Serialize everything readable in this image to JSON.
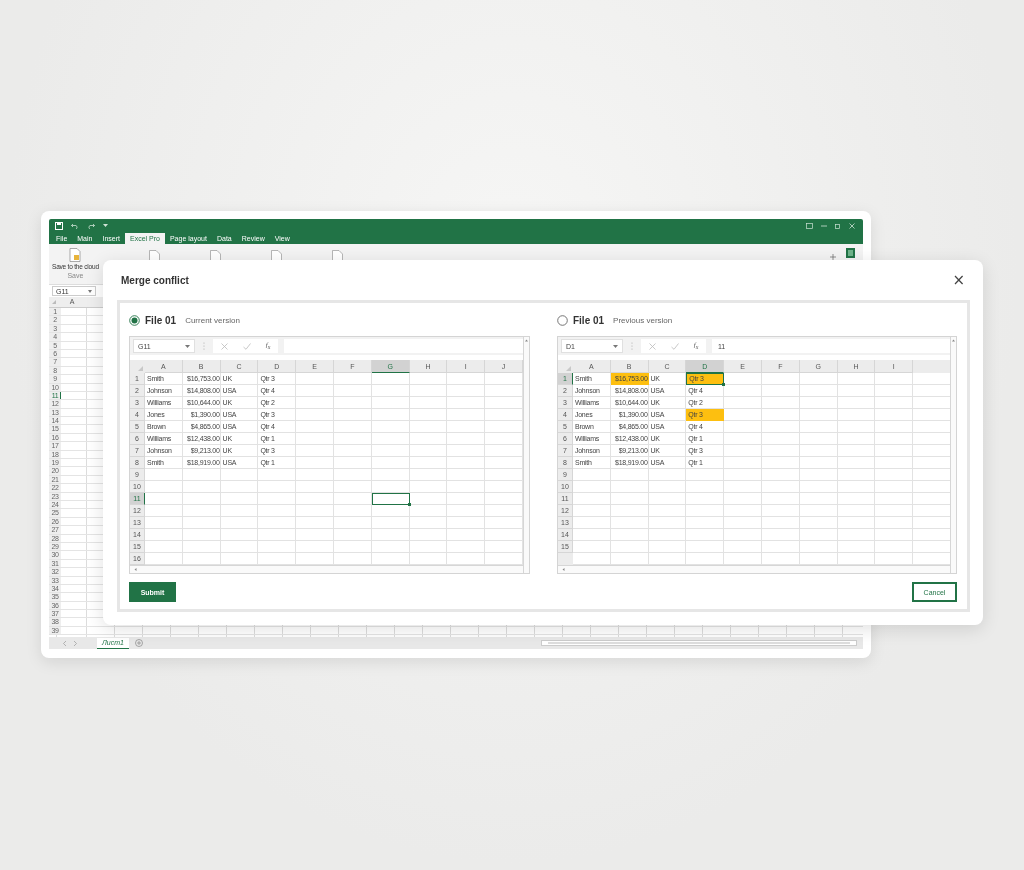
{
  "background_window": {
    "tabs": [
      {
        "label": "File",
        "selected": false
      },
      {
        "label": "Main",
        "selected": false
      },
      {
        "label": "Insert",
        "selected": false
      },
      {
        "label": "Excel Pro",
        "selected": true
      },
      {
        "label": "Page layout",
        "selected": false
      },
      {
        "label": "Data",
        "selected": false
      },
      {
        "label": "Review",
        "selected": false
      },
      {
        "label": "View",
        "selected": false
      }
    ],
    "ribbon_button": "Save to the cloud",
    "ribbon_group": "Save",
    "name_box": "G11",
    "column_headers": [
      "A"
    ],
    "row_numbers": [
      {
        "label": "1",
        "selected": false
      },
      {
        "label": "2",
        "selected": false
      },
      {
        "label": "3",
        "selected": false
      },
      {
        "label": "4",
        "selected": false
      },
      {
        "label": "5",
        "selected": false
      },
      {
        "label": "6",
        "selected": false
      },
      {
        "label": "7",
        "selected": false
      },
      {
        "label": "8",
        "selected": false
      },
      {
        "label": "9",
        "selected": false
      },
      {
        "label": "10",
        "selected": false
      },
      {
        "label": "11",
        "selected": true
      },
      {
        "label": "12",
        "selected": false
      },
      {
        "label": "13",
        "selected": false
      },
      {
        "label": "14",
        "selected": false
      },
      {
        "label": "15",
        "selected": false
      },
      {
        "label": "16",
        "selected": false
      },
      {
        "label": "17",
        "selected": false
      },
      {
        "label": "18",
        "selected": false
      },
      {
        "label": "19",
        "selected": false
      },
      {
        "label": "20",
        "selected": false
      },
      {
        "label": "21",
        "selected": false
      },
      {
        "label": "22",
        "selected": false
      },
      {
        "label": "23",
        "selected": false
      },
      {
        "label": "24",
        "selected": false
      },
      {
        "label": "25",
        "selected": false
      },
      {
        "label": "26",
        "selected": false
      },
      {
        "label": "27",
        "selected": false
      },
      {
        "label": "28",
        "selected": false
      },
      {
        "label": "29",
        "selected": false
      },
      {
        "label": "30",
        "selected": false
      },
      {
        "label": "31",
        "selected": false
      },
      {
        "label": "32",
        "selected": false
      },
      {
        "label": "33",
        "selected": false
      },
      {
        "label": "34",
        "selected": false
      },
      {
        "label": "35",
        "selected": false
      },
      {
        "label": "36",
        "selected": false
      },
      {
        "label": "37",
        "selected": false
      },
      {
        "label": "38",
        "selected": false
      },
      {
        "label": "39",
        "selected": false
      }
    ],
    "sheet_tab": "Лист1"
  },
  "dialog": {
    "title": "Merge conflict",
    "close": "×",
    "panels": [
      {
        "selected": true,
        "file": "File 01",
        "version": "Current version",
        "name_box": "G11",
        "fx": "f$_{x}$",
        "columns": [
          {
            "label": "A",
            "selected": false
          },
          {
            "label": "B",
            "selected": false
          },
          {
            "label": "C",
            "selected": false
          },
          {
            "label": "D",
            "selected": false
          },
          {
            "label": "E",
            "selected": false
          },
          {
            "label": "F",
            "selected": false
          },
          {
            "label": "G",
            "selected": true
          },
          {
            "label": "H",
            "selected": false
          },
          {
            "label": "I",
            "selected": false
          },
          {
            "label": "J",
            "selected": false
          }
        ],
        "rows": [
          {
            "label": "1",
            "selected": false,
            "cells": [
              {
                "text": "Smith",
                "highlighted": false
              },
              {
                "text": "$16,753.00",
                "highlighted": false
              },
              {
                "text": "UK",
                "highlighted": false
              },
              {
                "text": "Qtr 3",
                "highlighted": false
              }
            ]
          },
          {
            "label": "2",
            "selected": false,
            "cells": [
              {
                "text": "Johnson",
                "highlighted": false
              },
              {
                "text": "$14,808.00",
                "highlighted": false
              },
              {
                "text": "USA",
                "highlighted": false
              },
              {
                "text": "Qtr 4",
                "highlighted": false
              }
            ]
          },
          {
            "label": "3",
            "selected": false,
            "cells": [
              {
                "text": "Williams",
                "highlighted": false
              },
              {
                "text": "$10,644.00",
                "highlighted": false
              },
              {
                "text": "UK",
                "highlighted": false
              },
              {
                "text": "Qtr 2",
                "highlighted": false
              }
            ]
          },
          {
            "label": "4",
            "selected": false,
            "cells": [
              {
                "text": "Jones",
                "highlighted": false
              },
              {
                "text": "$1,390.00",
                "highlighted": false
              },
              {
                "text": "USA",
                "highlighted": false
              },
              {
                "text": "Qtr 3",
                "highlighted": false
              }
            ]
          },
          {
            "label": "5",
            "selected": false,
            "cells": [
              {
                "text": "Brown",
                "highlighted": false
              },
              {
                "text": "$4,865.00",
                "highlighted": false
              },
              {
                "text": "USA",
                "highlighted": false
              },
              {
                "text": "Qtr 4",
                "highlighted": false
              }
            ]
          },
          {
            "label": "6",
            "selected": false,
            "cells": [
              {
                "text": "Williams",
                "highlighted": false
              },
              {
                "text": "$12,438.00",
                "highlighted": false
              },
              {
                "text": "UK",
                "highlighted": false
              },
              {
                "text": "Qtr 1",
                "highlighted": false
              }
            ]
          },
          {
            "label": "7",
            "selected": false,
            "cells": [
              {
                "text": "Johnson",
                "highlighted": false
              },
              {
                "text": "$9,213.00",
                "highlighted": false
              },
              {
                "text": "UK",
                "highlighted": false
              },
              {
                "text": "Qtr 3",
                "highlighted": false
              }
            ]
          },
          {
            "label": "8",
            "selected": false,
            "cells": [
              {
                "text": "Smith",
                "highlighted": false
              },
              {
                "text": "$18,919.00",
                "highlighted": false
              },
              {
                "text": "USA",
                "highlighted": false
              },
              {
                "text": "Qtr 1",
                "highlighted": false
              }
            ]
          },
          {
            "label": "9",
            "selected": false
          },
          {
            "label": "10",
            "selected": false
          },
          {
            "label": "11",
            "selected": true
          },
          {
            "label": "12",
            "selected": false
          },
          {
            "label": "13",
            "selected": false
          },
          {
            "label": "14",
            "selected": false
          },
          {
            "label": "15",
            "selected": false
          },
          {
            "label": "16",
            "selected": false
          }
        ]
      },
      {
        "selected": false,
        "file": "File 01",
        "version": "Previous version",
        "name_box": "D1",
        "fx": "f$_{x}$",
        "formula": "11",
        "columns": [
          {
            "label": "A",
            "selected": false
          },
          {
            "label": "B",
            "selected": false
          },
          {
            "label": "C",
            "selected": false
          },
          {
            "label": "D",
            "selected": true
          },
          {
            "label": "E",
            "selected": false
          },
          {
            "label": "F",
            "selected": false
          },
          {
            "label": "G",
            "selected": false
          },
          {
            "label": "H",
            "selected": false
          },
          {
            "label": "I",
            "selected": false
          }
        ],
        "rows": [
          {
            "label": "1",
            "selected": true,
            "cells": [
              {
                "text": "Smith",
                "highlighted": false
              },
              {
                "text": "$16,753.00",
                "highlighted": true
              },
              {
                "text": "UK",
                "highlighted": false
              },
              {
                "text": "Qtr 3",
                "highlighted": true
              }
            ]
          },
          {
            "label": "2",
            "selected": false,
            "cells": [
              {
                "text": "Johnson",
                "highlighted": false
              },
              {
                "text": "$14,808.00",
                "highlighted": false
              },
              {
                "text": "USA",
                "highlighted": false
              },
              {
                "text": "Qtr 4",
                "highlighted": false
              }
            ]
          },
          {
            "label": "3",
            "selected": false,
            "cells": [
              {
                "text": "Williams",
                "highlighted": false
              },
              {
                "text": "$10,644.00",
                "highlighted": false
              },
              {
                "text": "UK",
                "highlighted": false
              },
              {
                "text": "Qtr 2",
                "highlighted": false
              }
            ]
          },
          {
            "label": "4",
            "selected": false,
            "cells": [
              {
                "text": "Jones",
                "highlighted": false
              },
              {
                "text": "$1,390.00",
                "highlighted": false
              },
              {
                "text": "USA",
                "highlighted": false
              },
              {
                "text": "Qtr 3",
                "highlighted": true
              }
            ]
          },
          {
            "label": "5",
            "selected": false,
            "cells": [
              {
                "text": "Brown",
                "highlighted": false
              },
              {
                "text": "$4,865.00",
                "highlighted": false
              },
              {
                "text": "USA",
                "highlighted": false
              },
              {
                "text": "Qtr 4",
                "highlighted": false
              }
            ]
          },
          {
            "label": "6",
            "selected": false,
            "cells": [
              {
                "text": "Williams",
                "highlighted": false
              },
              {
                "text": "$12,438.00",
                "highlighted": false
              },
              {
                "text": "UK",
                "highlighted": false
              },
              {
                "text": "Qtr 1",
                "highlighted": false
              }
            ]
          },
          {
            "label": "7",
            "selected": false,
            "cells": [
              {
                "text": "Johnson",
                "highlighted": false
              },
              {
                "text": "$9,213.00",
                "highlighted": false
              },
              {
                "text": "UK",
                "highlighted": false
              },
              {
                "text": "Qtr 3",
                "highlighted": false
              }
            ]
          },
          {
            "label": "8",
            "selected": false,
            "cells": [
              {
                "text": "Smith",
                "highlighted": false
              },
              {
                "text": "$18,919.00",
                "highlighted": false
              },
              {
                "text": "USA",
                "highlighted": false
              },
              {
                "text": "Qtr 1",
                "highlighted": false
              }
            ]
          },
          {
            "label": "9",
            "selected": false
          },
          {
            "label": "10",
            "selected": false
          },
          {
            "label": "11",
            "selected": false
          },
          {
            "label": "12",
            "selected": false
          },
          {
            "label": "13",
            "selected": false
          },
          {
            "label": "14",
            "selected": false
          },
          {
            "label": "15",
            "selected": false
          }
        ]
      }
    ],
    "buttons": [
      {
        "label": "Submit",
        "kind": "primary"
      },
      {
        "label": "Cancel",
        "kind": "secondary"
      }
    ]
  }
}
